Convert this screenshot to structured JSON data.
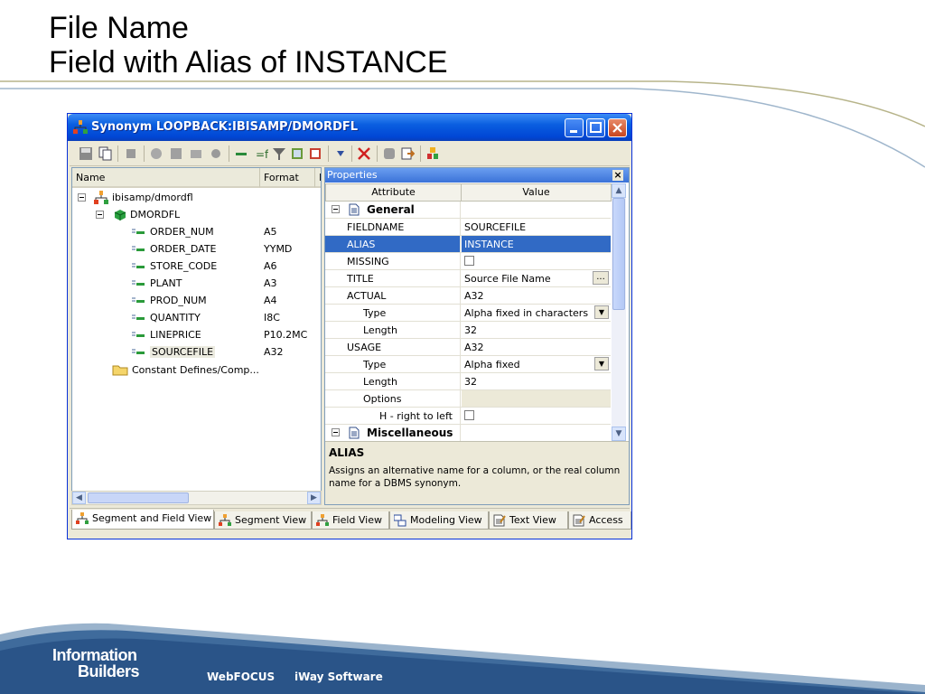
{
  "slide": {
    "title_line1": "File Name",
    "title_line2": "Field with Alias of INSTANCE"
  },
  "footer": {
    "logo_line1": "Information",
    "logo_line2": "Builders",
    "product1": "WebFOCUS",
    "product2": "iWay Software"
  },
  "window": {
    "title": "Synonym LOOPBACK:IBISAMP/DMORDFL",
    "tree": {
      "col_name": "Name",
      "col_format": "Format",
      "col_extra": "E",
      "root": "ibisamp/dmordfl",
      "segment": "DMORDFL",
      "fields": [
        {
          "name": "ORDER_NUM",
          "format": "A5"
        },
        {
          "name": "ORDER_DATE",
          "format": "YYMD"
        },
        {
          "name": "STORE_CODE",
          "format": "A6"
        },
        {
          "name": "PLANT",
          "format": "A3"
        },
        {
          "name": "PROD_NUM",
          "format": "A4"
        },
        {
          "name": "QUANTITY",
          "format": "I8C"
        },
        {
          "name": "LINEPRICE",
          "format": "P10.2MC"
        },
        {
          "name": "SOURCEFILE",
          "format": "A32"
        }
      ],
      "constants": "Constant Defines/Comp..."
    },
    "properties": {
      "header": "Properties",
      "close": "×",
      "col_attribute": "Attribute",
      "col_value": "Value",
      "rows": [
        {
          "attr": "General",
          "value": ""
        },
        {
          "attr": "FIELDNAME",
          "value": "SOURCEFILE"
        },
        {
          "attr": "ALIAS",
          "value": "INSTANCE"
        },
        {
          "attr": "MISSING",
          "value": ""
        },
        {
          "attr": "TITLE",
          "value": "Source File Name"
        },
        {
          "attr": "ACTUAL",
          "value": "A32"
        },
        {
          "attr": "Type",
          "value": "Alpha fixed in characters"
        },
        {
          "attr": "Length",
          "value": "32"
        },
        {
          "attr": "USAGE",
          "value": "A32"
        },
        {
          "attr": "Type",
          "value": "Alpha fixed"
        },
        {
          "attr": "Length",
          "value": "32"
        },
        {
          "attr": "Options",
          "value": ""
        },
        {
          "attr": "H - right to left",
          "value": ""
        },
        {
          "attr": "Miscellaneous",
          "value": ""
        }
      ],
      "desc_title": "ALIAS",
      "desc_body": "Assigns an alternative name for a column, or the real column name for a DBMS synonym."
    },
    "tabs": [
      {
        "label": "Segment and Field View"
      },
      {
        "label": "Segment View"
      },
      {
        "label": "Field View"
      },
      {
        "label": "Modeling View"
      },
      {
        "label": "Text View"
      },
      {
        "label": "Access"
      }
    ]
  },
  "colors": {
    "title_blue": "#0a5ee0",
    "selection": "#316ac5",
    "footer_blue": "#2d5f9a"
  }
}
